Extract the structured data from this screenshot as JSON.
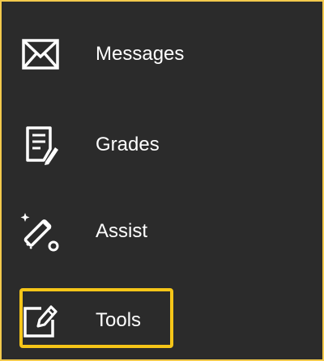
{
  "nav": {
    "items": [
      {
        "label": "Messages",
        "icon": "envelope-icon"
      },
      {
        "label": "Grades",
        "icon": "gradebook-icon"
      },
      {
        "label": "Assist",
        "icon": "magic-wand-icon"
      },
      {
        "label": "Tools",
        "icon": "edit-tool-icon"
      }
    ],
    "selected_index": 3
  },
  "colors": {
    "background": "#2b2b2b",
    "text": "#ffffff",
    "frame_border": "#f2c94c",
    "highlight": "#f5c518"
  }
}
